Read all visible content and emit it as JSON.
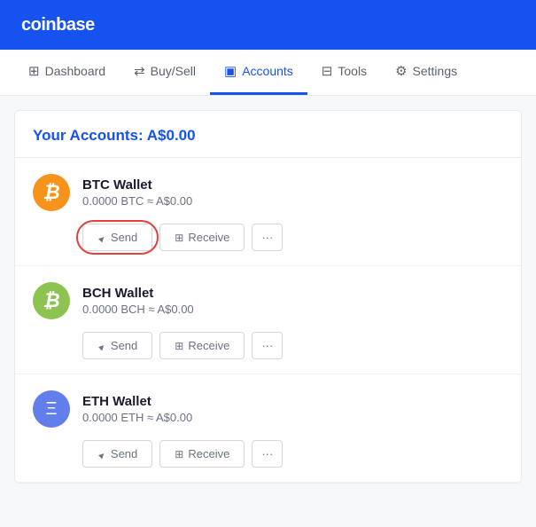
{
  "header": {
    "logo": "coinbase"
  },
  "nav": {
    "items": [
      {
        "id": "dashboard",
        "label": "Dashboard",
        "icon": "⊞",
        "active": false
      },
      {
        "id": "buysell",
        "label": "Buy/Sell",
        "icon": "⇄",
        "active": false
      },
      {
        "id": "accounts",
        "label": "Accounts",
        "icon": "▣",
        "active": true
      },
      {
        "id": "tools",
        "label": "Tools",
        "icon": "⊟",
        "active": false
      },
      {
        "id": "settings",
        "label": "Settings",
        "icon": "⚙",
        "active": false
      }
    ]
  },
  "main": {
    "accounts_heading": "Your Accounts: A$0.00",
    "wallets": [
      {
        "id": "btc",
        "name": "BTC Wallet",
        "balance": "0.0000 BTC ≈ A$0.00",
        "symbol": "₿",
        "color_class": "btc"
      },
      {
        "id": "bch",
        "name": "BCH Wallet",
        "balance": "0.0000 BCH ≈ A$0.00",
        "symbol": "₿",
        "color_class": "bch"
      },
      {
        "id": "eth",
        "name": "ETH Wallet",
        "balance": "0.0000 ETH ≈ A$0.00",
        "symbol": "Ξ",
        "color_class": "eth"
      }
    ],
    "buttons": {
      "send": "Send",
      "receive": "Receive",
      "more": "···"
    }
  }
}
